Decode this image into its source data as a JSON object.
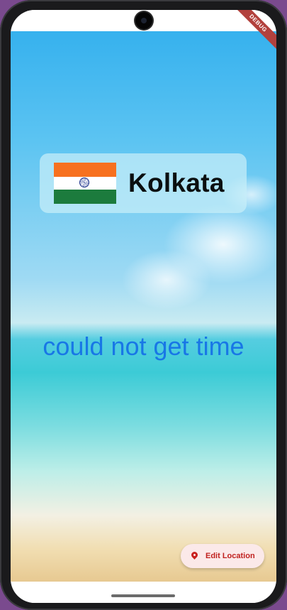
{
  "app": {
    "debug_banner": "DEBUG"
  },
  "location": {
    "flag_icon": "india-flag-icon",
    "city": "Kolkata"
  },
  "time": {
    "text": "could not get time"
  },
  "actions": {
    "edit_location_label": "Edit Location",
    "edit_location_icon": "location-pin-icon",
    "accent_color": "#c0211f"
  }
}
